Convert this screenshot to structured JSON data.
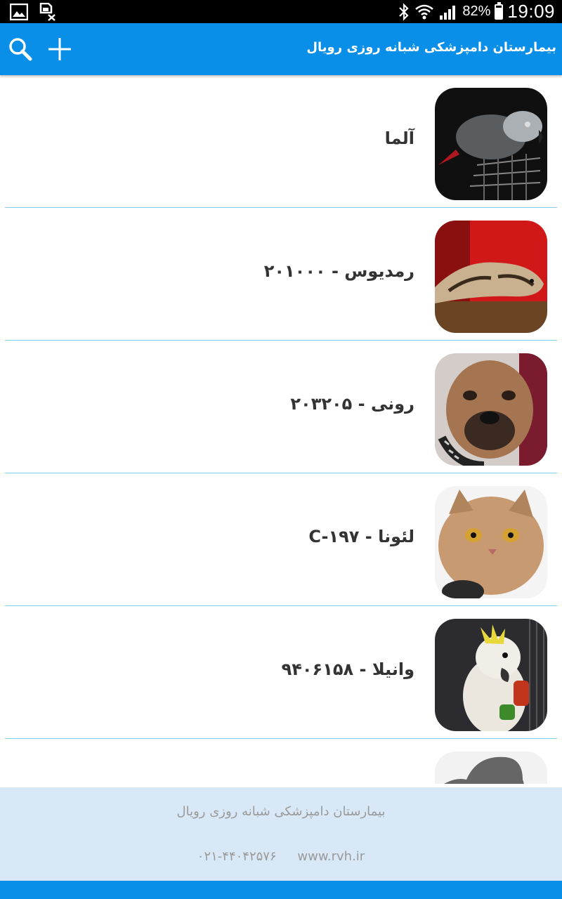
{
  "status_bar": {
    "battery": "82%",
    "battery_level": 0.82,
    "time": "19:09",
    "icons": [
      "gallery-icon",
      "sim-icon",
      "bluetooth-icon",
      "wifi-icon",
      "signal-icon",
      "battery-icon"
    ]
  },
  "app_bar": {
    "title": "بیمارستان دامپزشکی شبانه روزی رویال",
    "color": "#0a8fe8",
    "icons": [
      "search-icon",
      "add-icon"
    ]
  },
  "patients": [
    {
      "label": "آلما",
      "photo": "parrot-photo"
    },
    {
      "label": "رمدیوس  -  ۲۰۱۰۰۰",
      "photo": "snake-photo"
    },
    {
      "label": "رونی  -  ۲۰۳۲۰۵",
      "photo": "dog-photo"
    },
    {
      "label": "لئونا  -  C-۱۹۷",
      "photo": "cat-photo"
    },
    {
      "label": "وانیلا  -  ۹۴۰۶۱۵۸",
      "photo": "cockatoo-photo"
    },
    {
      "label": "",
      "photo": "placeholder-photo"
    }
  ],
  "footer": {
    "hospital_name": "بیمارستان دامپزشکی شبانه روزی رویال",
    "phone": "۰۲۱-۴۴۰۴۲۵۷۶",
    "website": "www.rvh.ir",
    "background": "#d8e8f6"
  }
}
